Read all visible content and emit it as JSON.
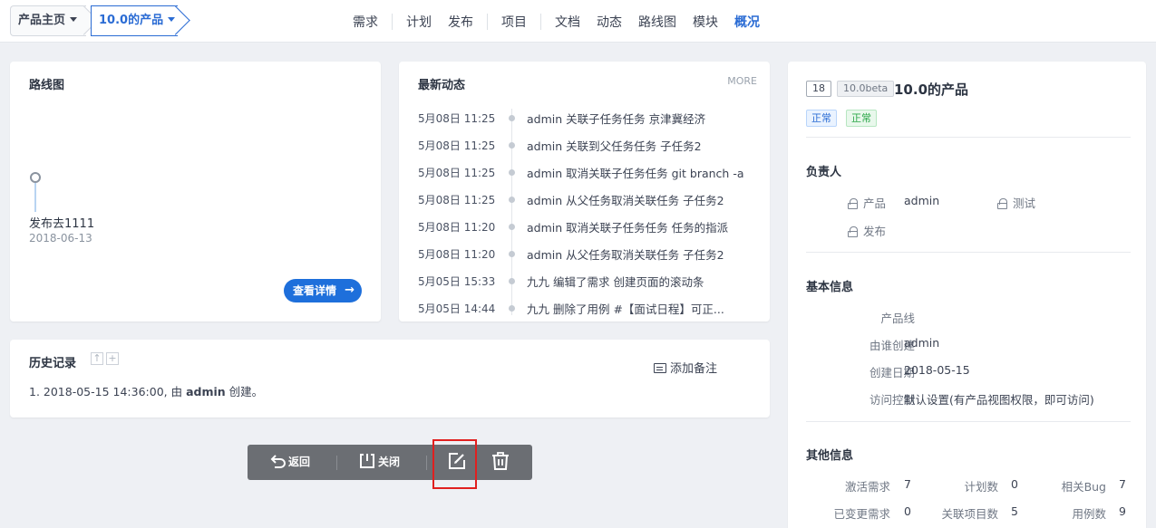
{
  "breadcrumb": {
    "home": "产品主页",
    "product": "10.0的产品"
  },
  "nav": [
    "需求",
    "计划",
    "发布",
    "项目",
    "文档",
    "动态",
    "路线图",
    "模块",
    "概况"
  ],
  "roadmap": {
    "title": "路线图",
    "release_name": "发布去1111",
    "release_date": "2018-06-13",
    "detail_button": "查看详情"
  },
  "dynamics": {
    "title": "最新动态",
    "more": "MORE",
    "items": [
      {
        "date": "5月08日 11:25",
        "text": "admin 关联子任务任务 京津冀经济"
      },
      {
        "date": "5月08日 11:25",
        "text": "admin 关联到父任务任务 子任务2"
      },
      {
        "date": "5月08日 11:25",
        "text": "admin 取消关联子任务任务 git branch -a"
      },
      {
        "date": "5月08日 11:25",
        "text": "admin 从父任务取消关联任务 子任务2"
      },
      {
        "date": "5月08日 11:20",
        "text": "admin 取消关联子任务任务 任务的指派"
      },
      {
        "date": "5月08日 11:20",
        "text": "admin 从父任务取消关联任务 子任务2"
      },
      {
        "date": "5月05日 15:33",
        "text": "九九 编辑了需求 创建页面的滚动条"
      },
      {
        "date": "5月05日 14:44",
        "text": "九九 删除了用例 #【面试日程】可正..."
      }
    ]
  },
  "history": {
    "title": "历史记录",
    "add_note": "添加备注",
    "entry_prefix": "1. 2018-05-15 14:36:00, 由 ",
    "entry_user": "admin",
    "entry_suffix": " 创建。"
  },
  "actions": {
    "back": "返回",
    "close": "关闭"
  },
  "product": {
    "id": "18",
    "version": "10.0beta",
    "name": "10.0的产品",
    "status1": "正常",
    "status2": "正常",
    "owners_title": "负责人",
    "owner_product_label": "产品",
    "owner_product_value": "admin",
    "owner_test_label": "测试",
    "owner_release_label": "发布",
    "basic_title": "基本信息",
    "line_label": "产品线",
    "creator_label": "由谁创建",
    "creator_value": "admin",
    "created_label": "创建日期",
    "created_value": "2018-05-15",
    "acl_label": "访问控制",
    "acl_value": "默认设置(有产品视图权限，即可访问)",
    "other_title": "其他信息",
    "active_req_label": "激活需求",
    "active_req_value": "7",
    "plans_label": "计划数",
    "plans_value": "0",
    "bugs_label": "相关Bug",
    "bugs_value": "7",
    "changed_req_label": "已变更需求",
    "changed_req_value": "0",
    "projects_label": "关联项目数",
    "projects_value": "5",
    "cases_label": "用例数",
    "cases_value": "9"
  }
}
